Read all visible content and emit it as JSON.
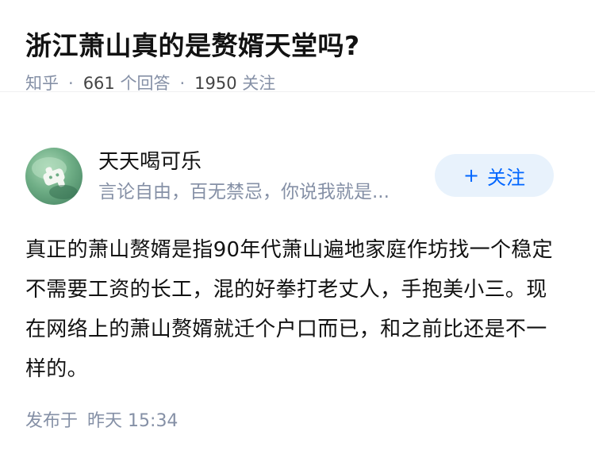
{
  "question": {
    "title": "浙江萧山真的是赘婿天堂吗?",
    "source": "知乎",
    "answer_count": "661",
    "answer_label": "个回答",
    "follower_count": "1950",
    "follower_label": "关注"
  },
  "answer": {
    "author_name": "天天喝可乐",
    "author_bio": "言论自由，百无禁忌，你说我就是...",
    "follow_label": "关注",
    "follow_icon": "plus-icon",
    "text": "真正的萧山赘婿是指90年代萧山遍地家庭作坊找一个稳定不需要工资的长工，混的好拳打老丈人，手抱美小三。现在网络上的萧山赘婿就迁个户口而已，和之前比还是不一样的。",
    "published_label": "发布于",
    "published_day": "昨天",
    "published_time": "15:34"
  },
  "colors": {
    "accent": "#0066ff",
    "follow_bg": "#e8f2fc",
    "meta_gray": "#8590a6"
  }
}
